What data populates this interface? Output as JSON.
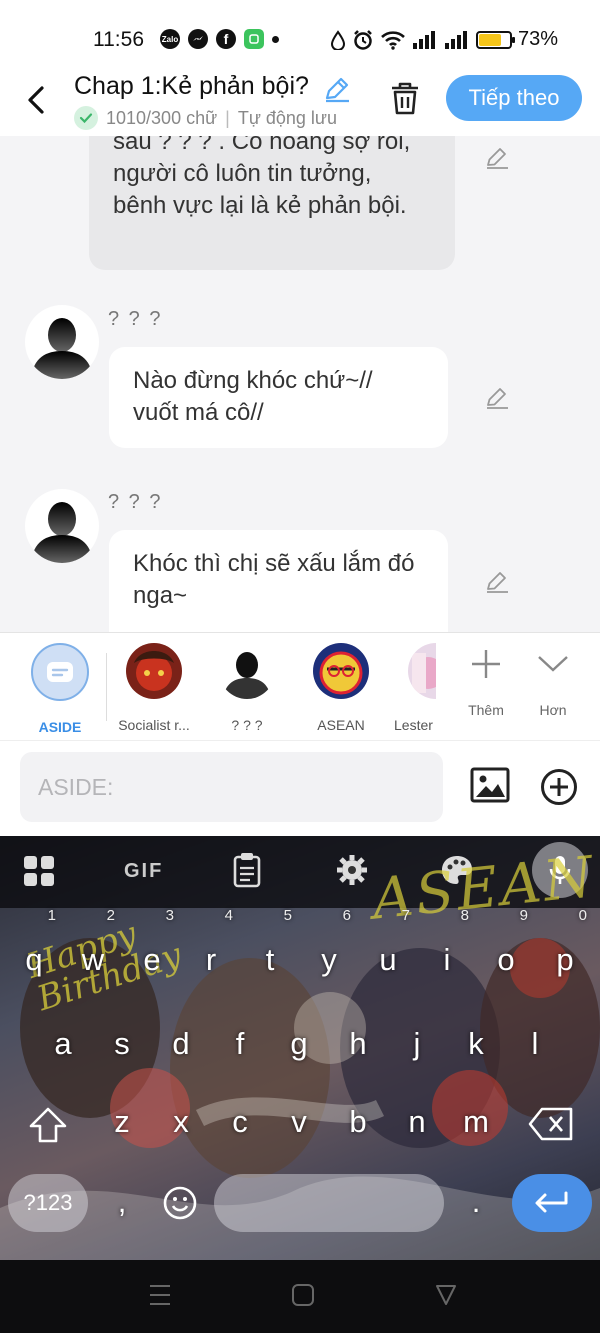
{
  "status_bar": {
    "time": "11:56",
    "app_icons": [
      "zalo-icon",
      "messenger-icon",
      "facebook-icon",
      "wechat-icon",
      "dot-icon"
    ],
    "battery": "73%",
    "battery_level": 0.73
  },
  "header": {
    "title": "Chap 1:Kẻ phản bội?",
    "word_count": "1010/300 chữ",
    "separator": "|",
    "autosave": "Tự động lưu",
    "next_label": "Tiếp theo"
  },
  "chat": {
    "messages": [
      {
        "speaker": "",
        "text": "sau ? ? ? . Cô hoảng sợ rồi, người cô luôn tin tưởng, bênh vực lại là kẻ phản bội."
      },
      {
        "speaker": "? ? ?",
        "text": "Nào đừng khóc chứ~// vuốt má cô//"
      },
      {
        "speaker": "? ? ?",
        "text": "Khóc thì chị sẽ xấu lắm đó nga~"
      }
    ]
  },
  "characters": [
    {
      "label": "ASIDE"
    },
    {
      "label": "Socialist r..."
    },
    {
      "label": "? ? ?"
    },
    {
      "label": "ASEAN"
    },
    {
      "label": "Lester"
    }
  ],
  "tools": {
    "add_label": "Thêm",
    "more_label": "Hơn"
  },
  "input": {
    "placeholder": "ASIDE:"
  },
  "keyboard": {
    "gif_label": "GIF",
    "row1": [
      "q",
      "w",
      "e",
      "r",
      "t",
      "y",
      "u",
      "i",
      "o",
      "p"
    ],
    "row1_nums": [
      "1",
      "2",
      "3",
      "4",
      "5",
      "6",
      "7",
      "8",
      "9",
      "0"
    ],
    "row2": [
      "a",
      "s",
      "d",
      "f",
      "g",
      "h",
      "j",
      "k",
      "l"
    ],
    "row3": [
      "z",
      "x",
      "c",
      "v",
      "b",
      "n",
      "m"
    ],
    "symbols_label": "?123",
    "comma": ",",
    "period": ".",
    "art_text_1": "Happy Birthday",
    "art_text_2": "ASEAN"
  },
  "colors": {
    "accent": "#56a8f5",
    "enter": "#4a8fe6",
    "selected_char": "#3a8ee6"
  }
}
